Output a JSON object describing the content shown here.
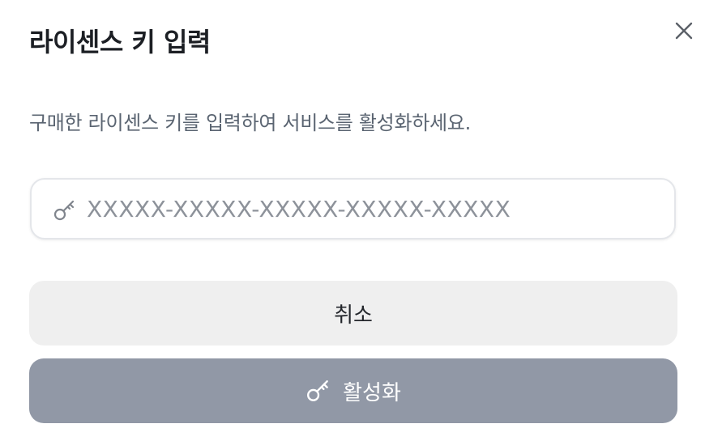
{
  "dialog": {
    "title": "라이센스 키 입력",
    "description": "구매한 라이센스 키를 입력하여 서비스를 활성화하세요.",
    "close_icon": "close-icon"
  },
  "license_input": {
    "value": "",
    "placeholder": "XXXXX-XXXXX-XXXXX-XXXXX-XXXXX",
    "icon": "key-icon"
  },
  "buttons": {
    "cancel_label": "취소",
    "activate_label": "활성화",
    "activate_icon": "key-icon"
  },
  "colors": {
    "activate_bg": "#9198a6",
    "cancel_bg": "#efefef",
    "description_text": "#5a6471",
    "placeholder_text": "#8d929a"
  }
}
